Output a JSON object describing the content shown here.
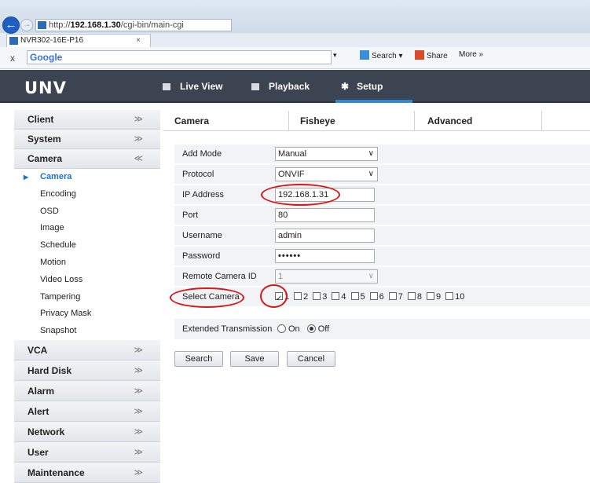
{
  "browser": {
    "address_prefix": "http://",
    "address_host": "192.168.1.30",
    "address_path": "/cgi-bin/main-cgi",
    "tab_title": "NVR302-16E-P16",
    "tab_close": "×",
    "toolbar_close": "x",
    "google_label": "Google",
    "dropdown_arrow": "▾",
    "search_label": "Search ▾",
    "share_label": "Share",
    "more_label": "More »"
  },
  "app": {
    "logo": "UNV",
    "nav": [
      {
        "label": "Live View"
      },
      {
        "label": "Playback"
      },
      {
        "label": "Setup"
      }
    ]
  },
  "sidebar": {
    "sections_top": [
      {
        "label": "Client",
        "chevron": "≫"
      },
      {
        "label": "System",
        "chevron": "≫"
      },
      {
        "label": "Camera",
        "chevron": "≪"
      }
    ],
    "camera_items": [
      {
        "label": "Camera"
      },
      {
        "label": "Encoding"
      },
      {
        "label": "OSD"
      },
      {
        "label": "Image"
      },
      {
        "label": "Schedule"
      },
      {
        "label": "Motion"
      },
      {
        "label": "Video Loss"
      },
      {
        "label": "Tampering"
      },
      {
        "label": "Privacy Mask"
      },
      {
        "label": "Snapshot"
      }
    ],
    "sections_bottom": [
      {
        "label": "VCA",
        "chevron": "≫"
      },
      {
        "label": "Hard Disk",
        "chevron": "≫"
      },
      {
        "label": "Alarm",
        "chevron": "≫"
      },
      {
        "label": "Alert",
        "chevron": "≫"
      },
      {
        "label": "Network",
        "chevron": "≫"
      },
      {
        "label": "User",
        "chevron": "≫"
      },
      {
        "label": "Maintenance",
        "chevron": "≫"
      }
    ]
  },
  "tabs": [
    {
      "label": "Camera"
    },
    {
      "label": "Fisheye"
    },
    {
      "label": "Advanced"
    }
  ],
  "form": {
    "add_mode_label": "Add Mode",
    "add_mode_value": "Manual",
    "protocol_label": "Protocol",
    "protocol_value": "ONVIF",
    "ip_label": "IP Address",
    "ip_value": "192.168.1.31",
    "port_label": "Port",
    "port_value": "80",
    "username_label": "Username",
    "username_value": "admin",
    "password_label": "Password",
    "password_value": "••••••",
    "remote_id_label": "Remote Camera ID",
    "remote_id_value": "1",
    "select_camera_label": "Select Camera",
    "cameras": [
      "1",
      "2",
      "3",
      "4",
      "5",
      "6",
      "7",
      "8",
      "9",
      "10"
    ],
    "cameras_checked": [
      true,
      false,
      false,
      false,
      false,
      false,
      false,
      false,
      false,
      false
    ],
    "ext_label": "Extended Transmission",
    "ext_on": "On",
    "ext_off": "Off",
    "ext_selected": "Off"
  },
  "buttons": {
    "search": "Search",
    "save": "Save",
    "cancel": "Cancel"
  },
  "colors": {
    "navbar": "#3b4450",
    "accent": "#2f88d6",
    "annotation": "#d4181c"
  }
}
